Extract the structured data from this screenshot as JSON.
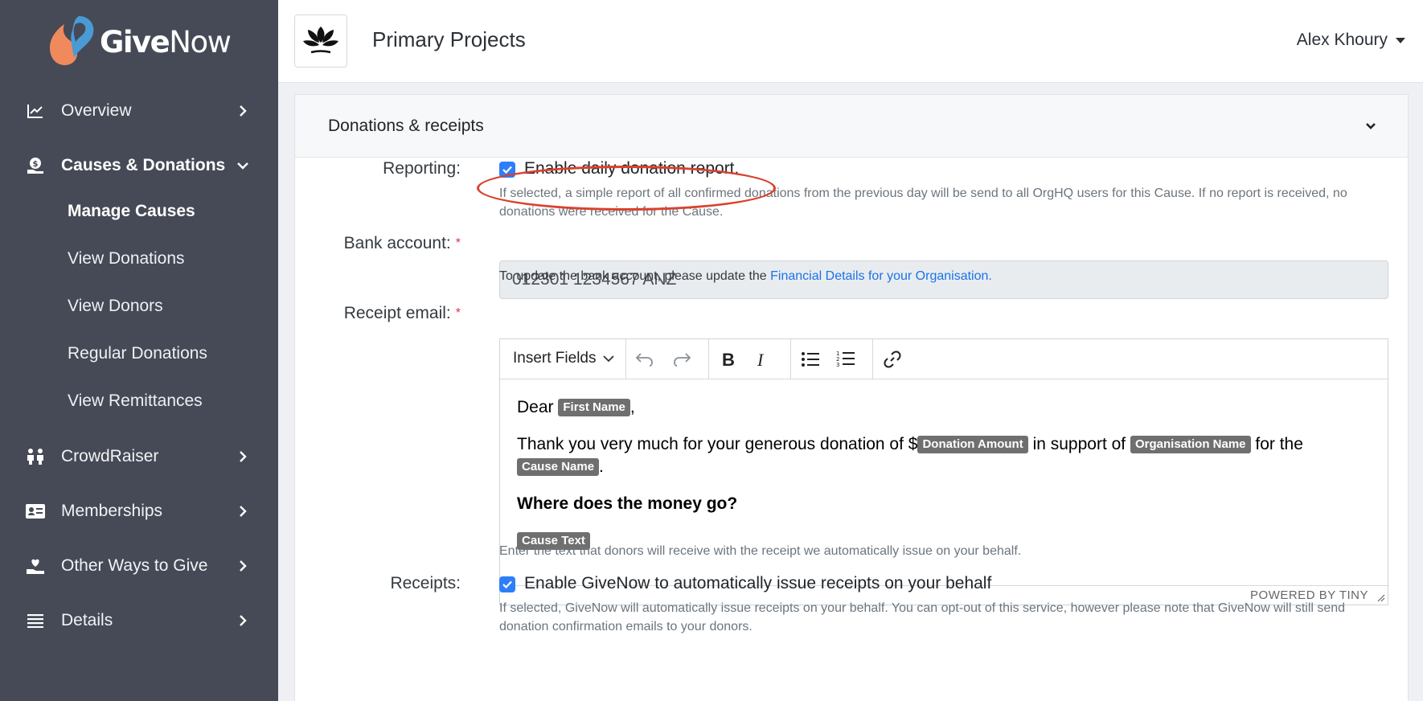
{
  "brand": {
    "name_bold": "Give",
    "name_light": "Now"
  },
  "sidebar": {
    "items": [
      {
        "label": "Overview",
        "icon": "line-chart-icon"
      },
      {
        "label": "Causes & Donations",
        "icon": "hand-coin-icon",
        "expanded": true
      },
      {
        "label": "CrowdRaiser",
        "icon": "people-icon"
      },
      {
        "label": "Memberships",
        "icon": "id-card-icon"
      },
      {
        "label": "Other Ways to Give",
        "icon": "hand-heart-icon"
      },
      {
        "label": "Details",
        "icon": "list-icon"
      }
    ],
    "subitems": [
      "Manage Causes",
      "View Donations",
      "View Donors",
      "Regular Donations",
      "View Remittances"
    ],
    "current_subitem": "Manage Causes"
  },
  "header": {
    "title": "Primary Projects",
    "user": "Alex Khoury"
  },
  "card": {
    "title": "Donations & receipts",
    "reporting": {
      "label": "Reporting:",
      "checkbox_label": "Enable daily donation report.",
      "checked": true,
      "help": "If selected, a simple report of all confirmed donations from the previous day will be send to all OrgHQ users for this Cause. If no report is received, no donations were received for the Cause."
    },
    "bank": {
      "label": "Bank account:",
      "required_mark": "*",
      "value": "012301 1234567 ANZ",
      "help_prefix": "To update the bank account, please update the",
      "help_link": "Financial Details for your Organisation."
    },
    "receipt_email": {
      "label": "Receipt email:",
      "required_mark": "*",
      "toolbar": {
        "insert_fields": "Insert Fields"
      },
      "body": {
        "dear": "Dear",
        "first_name_tag": "First Name",
        "comma": ",",
        "thanks_prefix": "Thank you very much for your generous donation of $",
        "donation_amount_tag": "Donation Amount",
        "in_support": "in support of",
        "org_name_tag": "Organisation Name",
        "for_the": "for the",
        "cause_name_tag": "Cause Name",
        "period": ".",
        "heading": "Where does the money go?",
        "cause_text_tag": "Cause Text"
      },
      "powered_by": "POWERED BY TINY",
      "help": "Enter the text that donors will receive with the receipt we automatically issue on your behalf."
    },
    "receipts": {
      "label": "Receipts:",
      "checkbox_label": "Enable GiveNow to automatically issue receipts on your behalf",
      "checked": true,
      "help": "If selected, GiveNow will automatically issue receipts on your behalf. You can opt-out of this service, however please note that GiveNow will still send donation confirmation emails to your donors."
    }
  },
  "colors": {
    "sidebar": "#454a56",
    "accent": "#2d7ff9",
    "highlight": "#d9412f",
    "tag": "#6f6f6f"
  }
}
